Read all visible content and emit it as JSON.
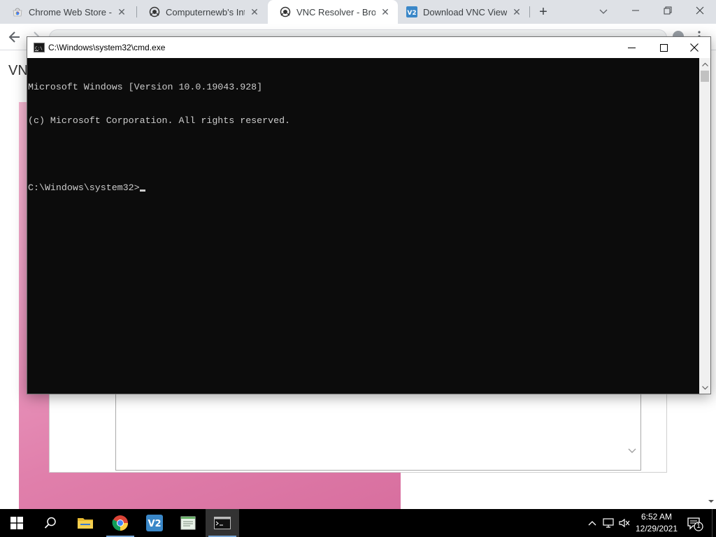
{
  "browser": {
    "tabs": [
      {
        "title": "Chrome Web Store - Ex",
        "icon": "chrome-web-store-icon",
        "active": false
      },
      {
        "title": "Computernewb's Intern",
        "icon": "computernewb-icon",
        "active": false
      },
      {
        "title": "VNC Resolver - Browse",
        "icon": "vnc-resolver-icon",
        "active": true
      },
      {
        "title": "Download VNC Viewer",
        "icon": "vnc-viewer-icon",
        "active": false
      }
    ],
    "close_glyph": "✕",
    "new_tab_glyph": "+",
    "page_heading": "VN",
    "accent": "#1a73e8"
  },
  "cmd": {
    "title": "C:\\Windows\\system32\\cmd.exe",
    "lines": [
      "Microsoft Windows [Version 10.0.19043.928]",
      "(c) Microsoft Corporation. All rights reserved.",
      "",
      "C:\\Windows\\system32>"
    ],
    "background": "#0c0c0c",
    "foreground": "#cccccc"
  },
  "taskbar": {
    "pinned": [
      "start-icon",
      "search-icon",
      "file-explorer-icon",
      "chrome-icon",
      "vnc-viewer-icon",
      "notepad-icon",
      "command-prompt-icon"
    ],
    "time": "6:52 AM",
    "date": "12/29/2021",
    "notification_count": "1"
  }
}
